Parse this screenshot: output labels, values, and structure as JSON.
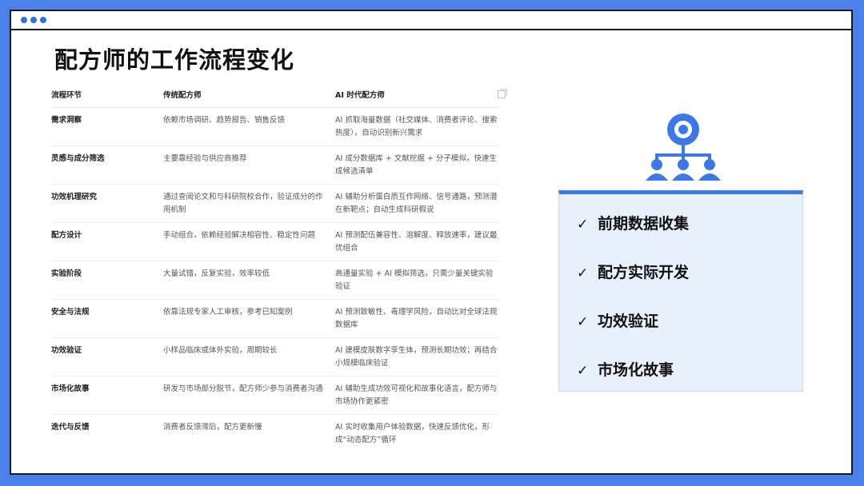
{
  "page": {
    "title": "配方师的工作流程变化",
    "accent_color": "#4a80e8",
    "title_bar_icons": [
      "window-dot-icon",
      "window-dot-icon",
      "window-dot-icon"
    ]
  },
  "table": {
    "headers": [
      "流程环节",
      "传统配方师",
      "AI 时代配方师"
    ],
    "rows": [
      {
        "stage": "需求洞察",
        "traditional": "依赖市场调研、趋势报告、销售反馈",
        "ai": "AI 抓取海量数据（社交媒体、消费者评论、搜索热度），自动识别新兴需求"
      },
      {
        "stage": "灵感与成分筛选",
        "traditional": "主要靠经验与供应商推荐",
        "ai": "AI 成分数据库 + 文献挖掘 + 分子模拟，快速生成候选清单"
      },
      {
        "stage": "功效机理研究",
        "traditional": "通过查阅论文和与科研院校合作，验证成分的作用机制",
        "ai": "AI 辅助分析蛋白质互作网络、信号通路，预测潜在新靶点；自动生成科研假说"
      },
      {
        "stage": "配方设计",
        "traditional": "手动组合，依赖经验解决相容性、稳定性问题",
        "ai": "AI 预测配伍兼容性、溶解度、释放速率，建议最优组合"
      },
      {
        "stage": "实验阶段",
        "traditional": "大量试错，反复实验，效率较低",
        "ai": "高通量实验 + AI 模拟筛选，只需少量关键实验验证"
      },
      {
        "stage": "安全与法规",
        "traditional": "依靠法规专家人工审核，参考已知案例",
        "ai": "AI 预测致敏性、毒理学风险，自动比对全球法规数据库"
      },
      {
        "stage": "功效验证",
        "traditional": "小样品临床或体外实验，周期较长",
        "ai": "AI 建模皮肤数字孪生体，预测长期功效；再结合小规模临床验证"
      },
      {
        "stage": "市场化故事",
        "traditional": "研发与市场部分脱节，配方师少参与消费者沟通",
        "ai": "AI 辅助生成功效可视化和故事化语言，配方师与市场协作更紧密"
      },
      {
        "stage": "迭代与反馈",
        "traditional": "消费者反馈滞后，配方更新慢",
        "ai": "AI 实时收集用户体验数据，快速反馈优化，形成“动态配方”循环"
      }
    ]
  },
  "panel": {
    "items": [
      "前期数据收集",
      "配方实际开发",
      "功效验证",
      "市场化故事"
    ],
    "check_icon": "check-icon",
    "graphic_icon": "org-network-icon"
  }
}
